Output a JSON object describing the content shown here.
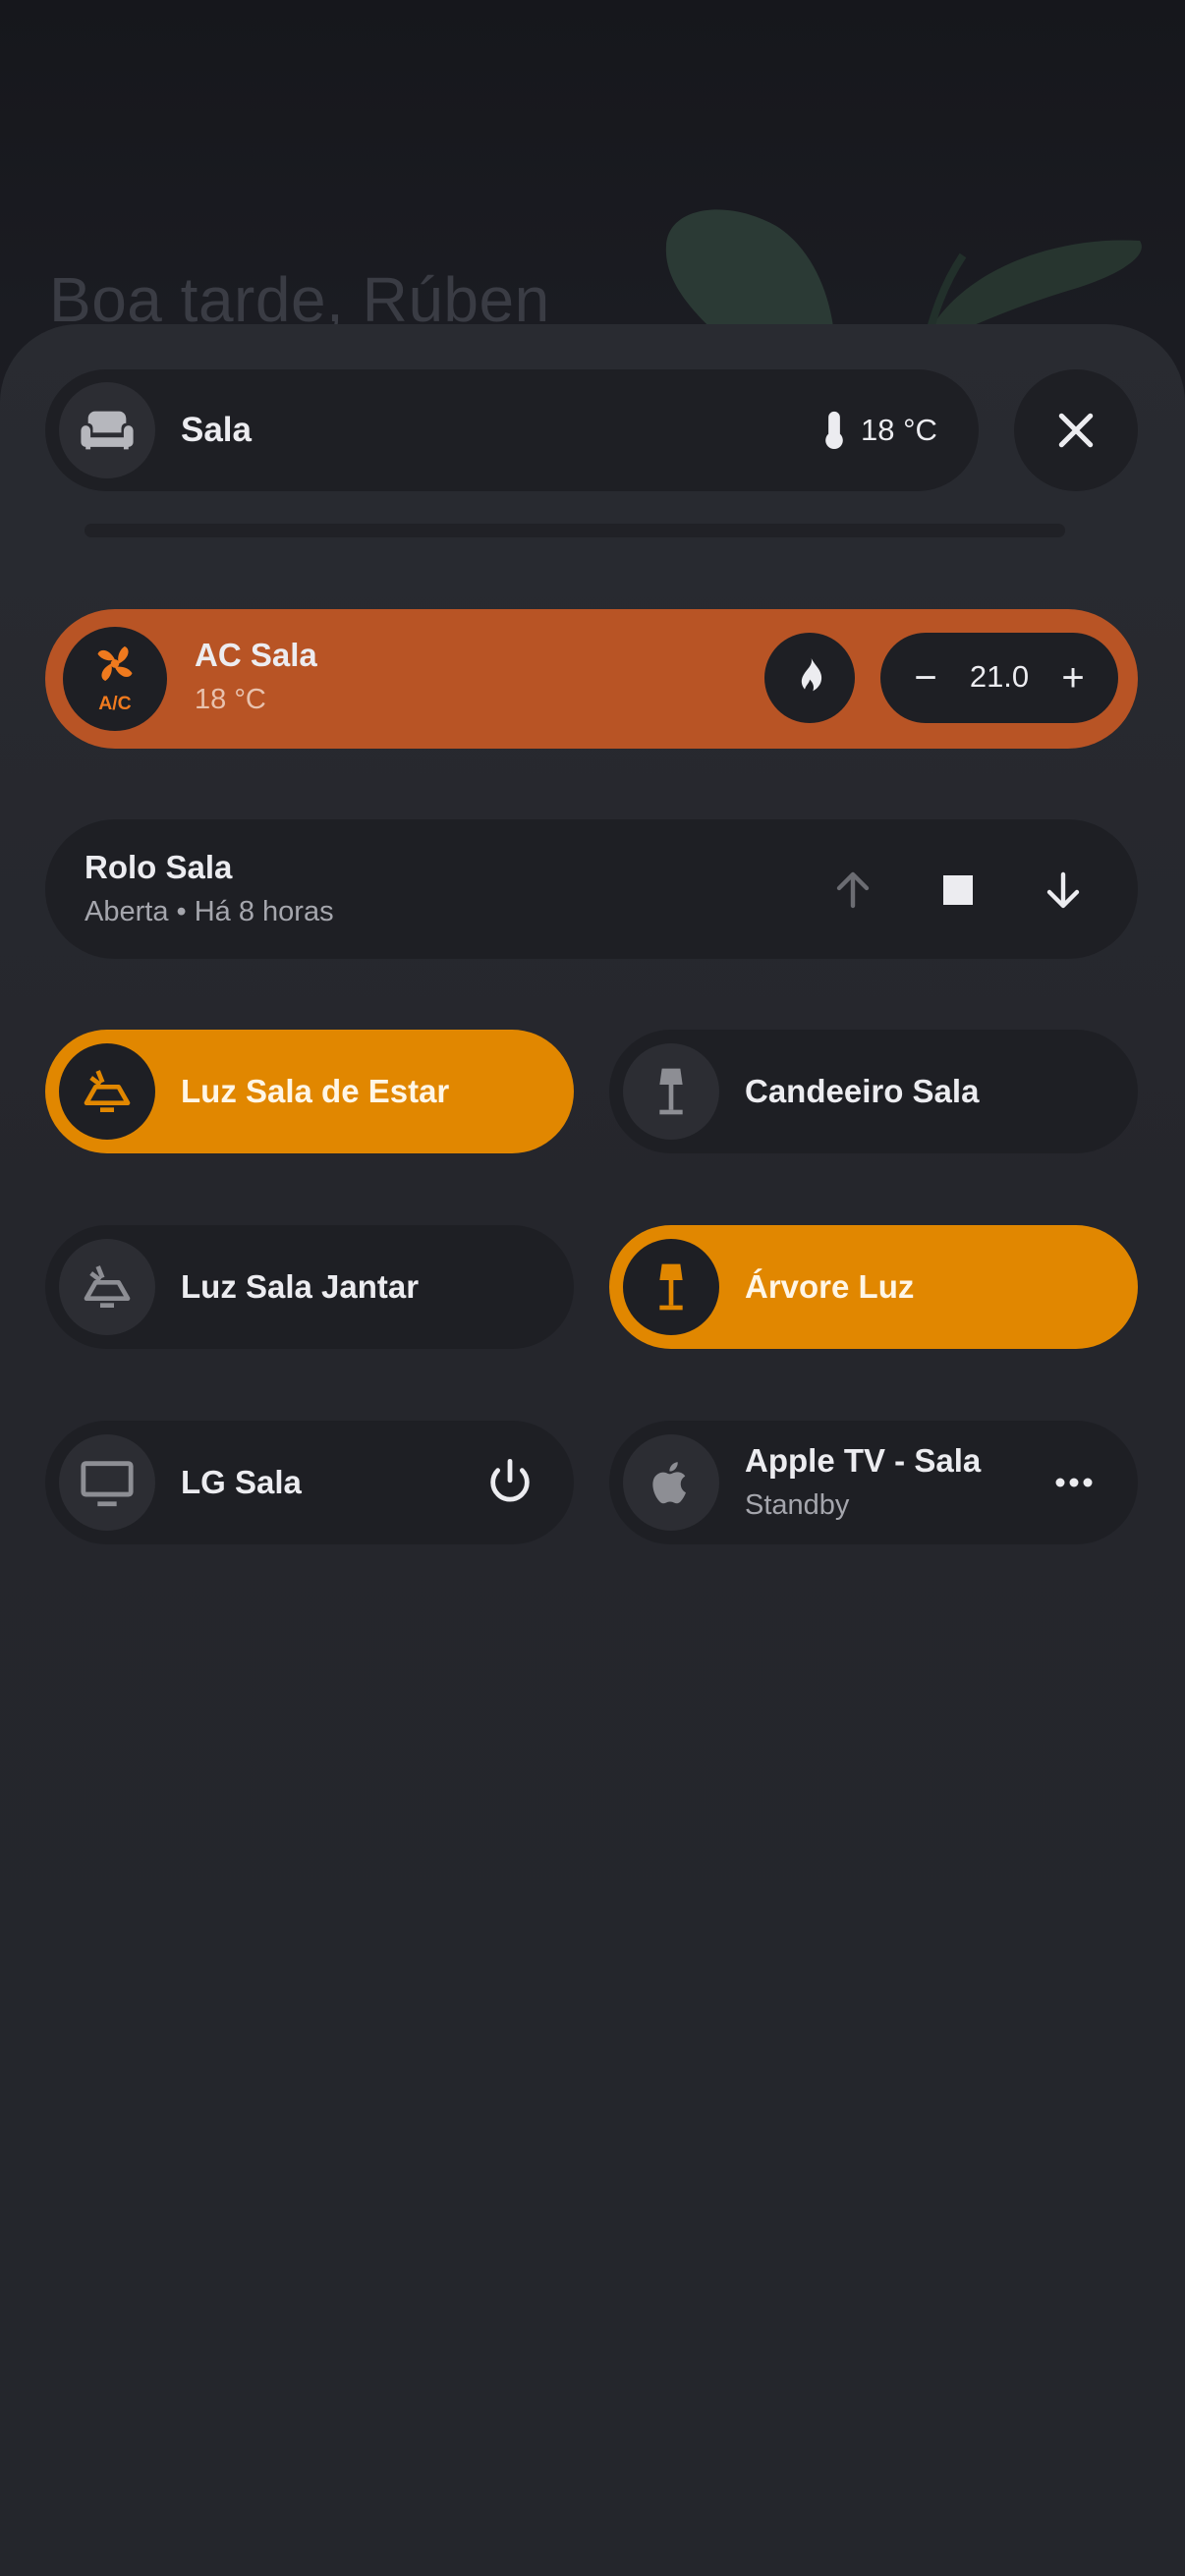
{
  "background": {
    "greeting": "Boa tarde, Rúben"
  },
  "header": {
    "room_icon": "sofa-icon",
    "room_name": "Sala",
    "temperature": "18 °C",
    "close_icon": "close-icon"
  },
  "climate": {
    "name": "AC Sala",
    "current_temp": "18 °C",
    "mode_icon": "fire-icon",
    "minus_label": "−",
    "setpoint": "21.0",
    "plus_label": "+",
    "accent": "#b85425"
  },
  "cover": {
    "name": "Rolo Sala",
    "state": "Aberta • Há 8 horas"
  },
  "tiles": [
    {
      "label": "Luz Sala de Estar",
      "icon": "ceiling-light-icon",
      "state": "on"
    },
    {
      "label": "Candeeiro Sala",
      "icon": "floor-lamp-icon",
      "state": "off"
    },
    {
      "label": "Luz Sala Jantar",
      "icon": "ceiling-light-icon",
      "state": "off"
    },
    {
      "label": "Árvore Luz",
      "icon": "floor-lamp-icon",
      "state": "on"
    }
  ],
  "media": [
    {
      "label": "LG Sala",
      "icon": "tv-icon",
      "action_icon": "power-icon"
    },
    {
      "label": "Apple TV - Sala",
      "state": "Standby",
      "icon": "apple-icon",
      "action_icon": "more-icon"
    }
  ],
  "colors": {
    "on": "#e18700",
    "tile": "#1e1f24",
    "text": "#ececf0",
    "muted": "#a5a6ad"
  }
}
